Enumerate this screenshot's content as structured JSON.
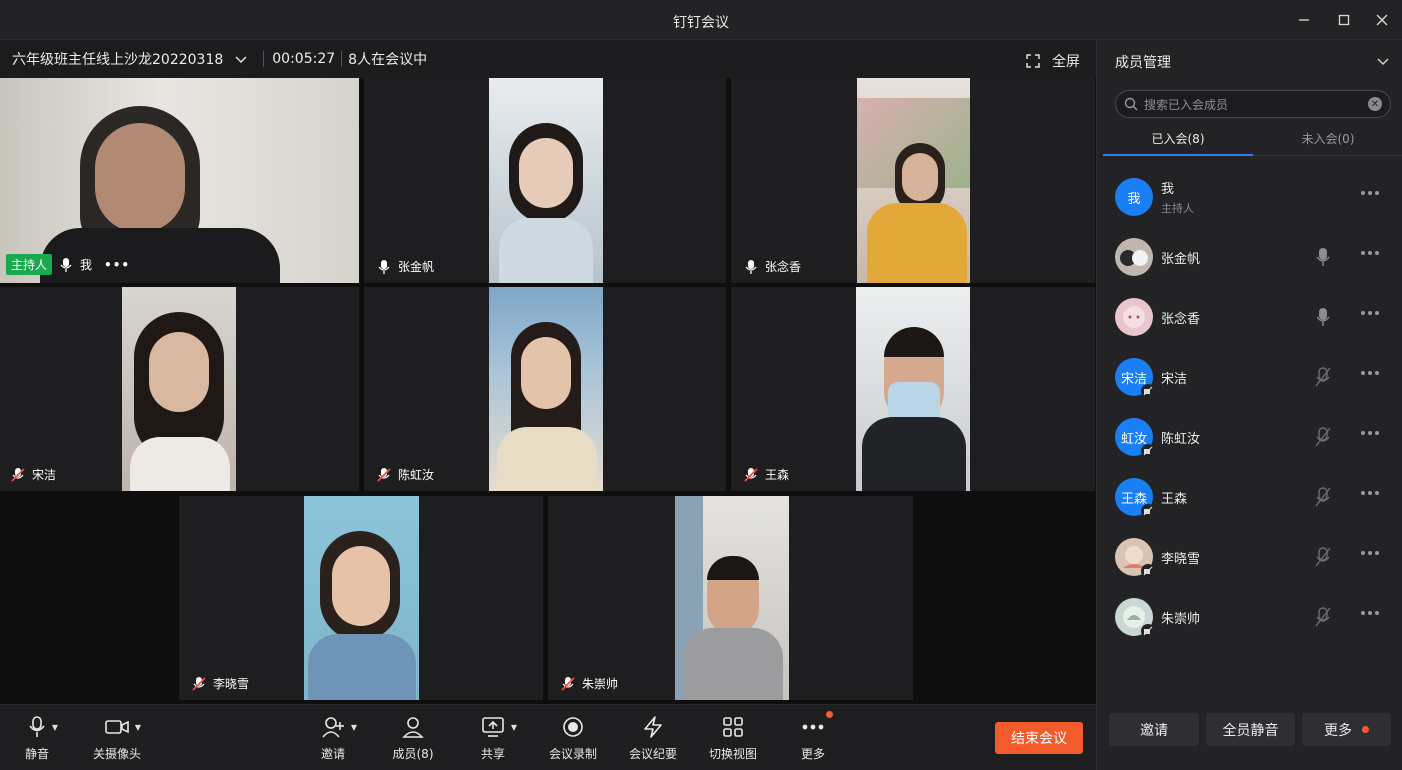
{
  "window": {
    "title": "钉钉会议"
  },
  "meeting": {
    "name": "六年级班主任线上沙龙20220318",
    "elapsed": "00:05:27",
    "attendee_count": "8人在会议中",
    "fullscreen_label": "全屏"
  },
  "tiles": [
    {
      "name": "我",
      "host_badge": "主持人",
      "mic": "on",
      "color": "#8a8478"
    },
    {
      "name": "张金帆",
      "mic": "on",
      "color": "#9aa3ab"
    },
    {
      "name": "张念香",
      "mic": "on",
      "color": "#c9a24a"
    },
    {
      "name": "宋洁",
      "mic": "off",
      "color": "#a99a8d"
    },
    {
      "name": "陈虹汝",
      "mic": "off",
      "color": "#c7b79a"
    },
    {
      "name": "王森",
      "mic": "off",
      "color": "#6a6f76"
    },
    {
      "name": "李晓雪",
      "mic": "off",
      "color": "#7aa7c2"
    },
    {
      "name": "朱崇帅",
      "mic": "off",
      "color": "#8a8e92"
    }
  ],
  "toolbar": {
    "mute": "静音",
    "camera_off": "关摄像头",
    "invite": "邀请",
    "members": "成员(8)",
    "share": "共享",
    "record": "会议录制",
    "minutes": "会议纪要",
    "switch_view": "切换视图",
    "more": "更多",
    "end_meeting": "结束会议"
  },
  "panel": {
    "title": "成员管理",
    "search_placeholder": "搜索已入会成员",
    "tab_joined": "已入会(8)",
    "tab_not_joined": "未入会(0)",
    "members": [
      {
        "name": "我",
        "role": "主持人",
        "avatar_text": "我",
        "mic": "none"
      },
      {
        "name": "张金帆",
        "avatar_text": "",
        "mic": "on",
        "avatar_color": "#bfb7ad"
      },
      {
        "name": "张念香",
        "avatar_text": "",
        "mic": "on",
        "avatar_color": "#e9c6cf"
      },
      {
        "name": "宋洁",
        "avatar_text": "宋洁",
        "mic": "off"
      },
      {
        "name": "陈虹汝",
        "avatar_text": "虹汝",
        "mic": "off"
      },
      {
        "name": "王森",
        "avatar_text": "王森",
        "mic": "off"
      },
      {
        "name": "李晓雪",
        "avatar_text": "",
        "mic": "off",
        "avatar_color": "#d9c3b3"
      },
      {
        "name": "朱崇帅",
        "avatar_text": "",
        "mic": "off",
        "avatar_color": "#c9d8d4"
      }
    ],
    "btn_invite": "邀请",
    "btn_mute_all": "全员静音",
    "btn_more": "更多"
  },
  "colors": {
    "accent": "#2e7cf6",
    "end": "#f25c2c",
    "host": "#1aa94c"
  }
}
